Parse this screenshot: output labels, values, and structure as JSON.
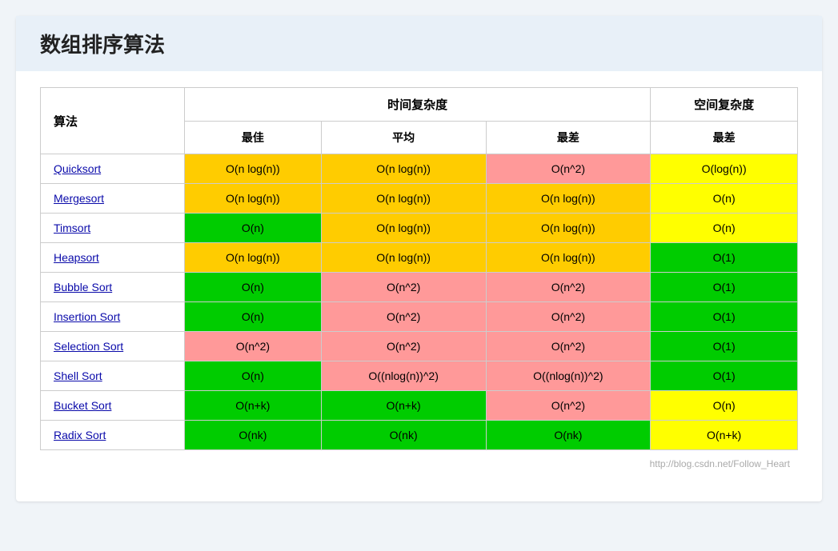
{
  "title": "数组排序算法",
  "footer": "http://blog.csdn.net/Follow_Heart",
  "table": {
    "headers": {
      "algo": "算法",
      "time_complexity": "时间复杂度",
      "space_complexity": "空间复杂度"
    },
    "subheaders": {
      "best": "最佳",
      "average": "平均",
      "worst_time": "最差",
      "worst_space": "最差"
    },
    "rows": [
      {
        "name": "Quicksort",
        "best": "O(n log(n))",
        "best_color": "orange",
        "average": "O(n log(n))",
        "average_color": "orange",
        "worst": "O(n^2)",
        "worst_color": "pink",
        "space": "O(log(n))",
        "space_color": "yellow"
      },
      {
        "name": "Mergesort",
        "best": "O(n log(n))",
        "best_color": "orange",
        "average": "O(n log(n))",
        "average_color": "orange",
        "worst": "O(n log(n))",
        "worst_color": "orange",
        "space": "O(n)",
        "space_color": "yellow"
      },
      {
        "name": "Timsort",
        "best": "O(n)",
        "best_color": "green-dark",
        "average": "O(n log(n))",
        "average_color": "orange",
        "worst": "O(n log(n))",
        "worst_color": "orange",
        "space": "O(n)",
        "space_color": "yellow"
      },
      {
        "name": "Heapsort",
        "best": "O(n log(n))",
        "best_color": "orange",
        "average": "O(n log(n))",
        "average_color": "orange",
        "worst": "O(n log(n))",
        "worst_color": "orange",
        "space": "O(1)",
        "space_color": "green-dark"
      },
      {
        "name": "Bubble Sort",
        "best": "O(n)",
        "best_color": "green-dark",
        "average": "O(n^2)",
        "average_color": "pink",
        "worst": "O(n^2)",
        "worst_color": "pink",
        "space": "O(1)",
        "space_color": "green-dark"
      },
      {
        "name": "Insertion Sort",
        "best": "O(n)",
        "best_color": "green-dark",
        "average": "O(n^2)",
        "average_color": "pink",
        "worst": "O(n^2)",
        "worst_color": "pink",
        "space": "O(1)",
        "space_color": "green-dark"
      },
      {
        "name": "Selection Sort",
        "best": "O(n^2)",
        "best_color": "pink",
        "average": "O(n^2)",
        "average_color": "pink",
        "worst": "O(n^2)",
        "worst_color": "pink",
        "space": "O(1)",
        "space_color": "green-dark"
      },
      {
        "name": "Shell Sort",
        "best": "O(n)",
        "best_color": "green-dark",
        "average": "O((nlog(n))^2)",
        "average_color": "pink",
        "worst": "O((nlog(n))^2)",
        "worst_color": "pink",
        "space": "O(1)",
        "space_color": "green-dark"
      },
      {
        "name": "Bucket Sort",
        "best": "O(n+k)",
        "best_color": "green-dark",
        "average": "O(n+k)",
        "average_color": "green-dark",
        "worst": "O(n^2)",
        "worst_color": "pink",
        "space": "O(n)",
        "space_color": "yellow"
      },
      {
        "name": "Radix Sort",
        "best": "O(nk)",
        "best_color": "green-dark",
        "average": "O(nk)",
        "average_color": "green-dark",
        "worst": "O(nk)",
        "worst_color": "green-dark",
        "space": "O(n+k)",
        "space_color": "yellow"
      }
    ]
  }
}
